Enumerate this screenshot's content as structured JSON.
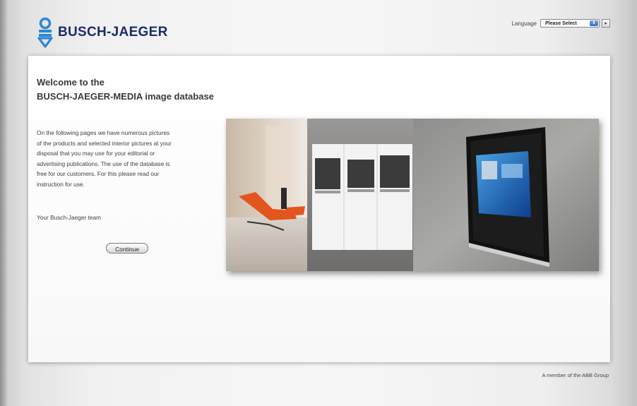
{
  "brand": {
    "name": "BUSCH-JAEGER",
    "logo_icon": "busch-jaeger-logo-icon",
    "color": "#1b2c6a"
  },
  "language": {
    "label": "Language",
    "selected": "Please Select",
    "go_icon": "chevron-right-icon"
  },
  "welcome": {
    "line1": "Welcome to the",
    "line2": "BUSCH-JAEGER-MEDIA image database",
    "paragraph_lines": [
      "On the following pages we have numerous pictures",
      "of the products and selected interior pictures at your",
      "disposal that you may use for your editorial or",
      "advertising publications. The use of the database is",
      "free for our customers. For this please read our",
      "instruction for use."
    ],
    "signoff": "Your Busch-Jaeger team",
    "continue_label": "Continue"
  },
  "footer": {
    "note": "A member of the ABB Group"
  }
}
